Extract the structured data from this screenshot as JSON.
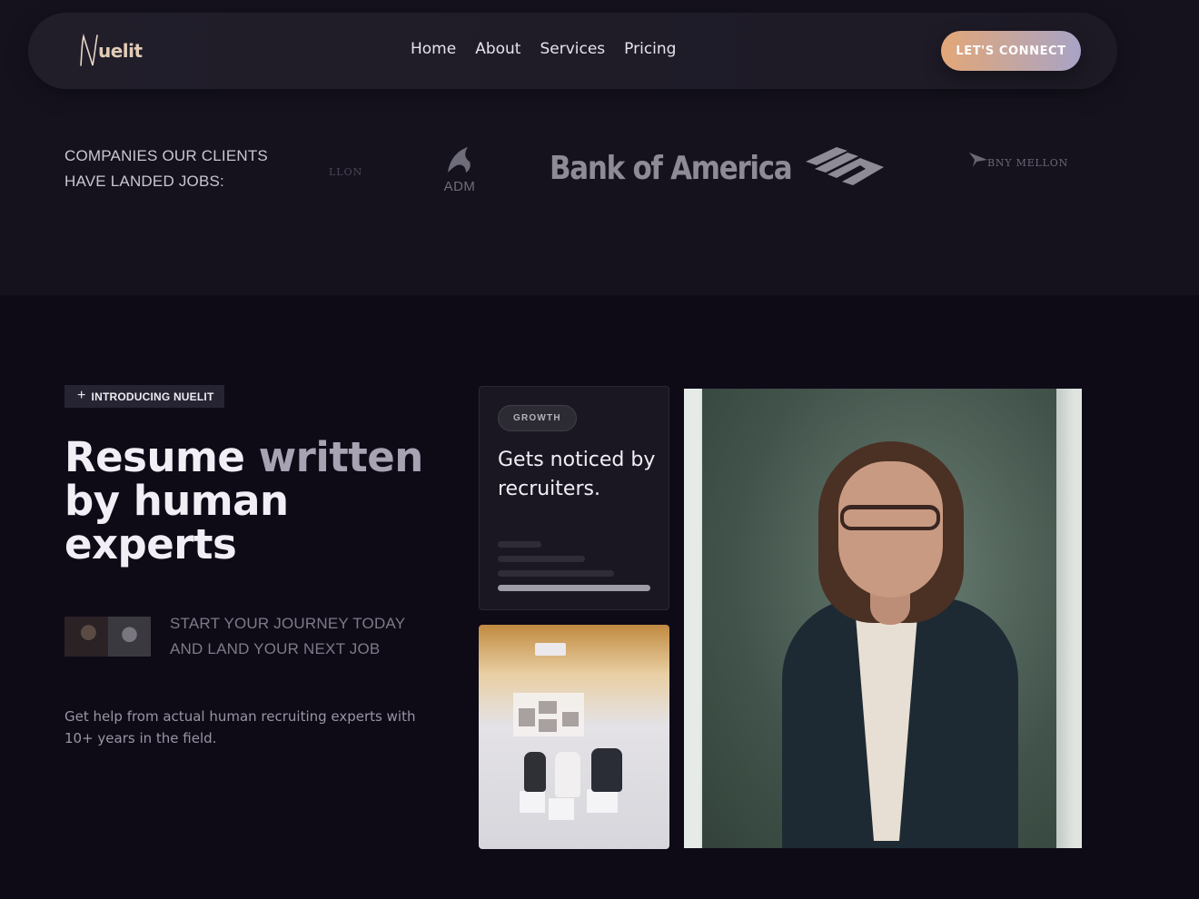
{
  "nav": {
    "logo_text": "uelit",
    "links": [
      "Home",
      "About",
      "Services",
      "Pricing"
    ],
    "cta_label": "LET'S CONNECT"
  },
  "companies": {
    "label_line1": "COMPANIES OUR CLIENTS",
    "label_line2": "HAVE LANDED JOBS:",
    "logos": {
      "bny_partial": "LLON",
      "adm": "ADM",
      "boa": "Bank of America",
      "bny": "BNY MELLON"
    }
  },
  "hero": {
    "tag": "INTRODUCING NUELIT",
    "headline_part1": "Resume",
    "headline_part2": " written",
    "headline_line2": "by human",
    "headline_line3": "experts",
    "journey_line1": "START YOUR JOURNEY TODAY",
    "journey_line2": "AND LAND YOUR NEXT JOB",
    "description": "Get help from actual human recruiting experts with 10+ years in the field."
  },
  "growth_card": {
    "badge": "GROWTH",
    "title": "Gets noticed by recruiters."
  },
  "colors": {
    "background": "#0e0b17",
    "cta_gradient_start": "#e3a777",
    "cta_gradient_end": "#a8a4c6"
  }
}
